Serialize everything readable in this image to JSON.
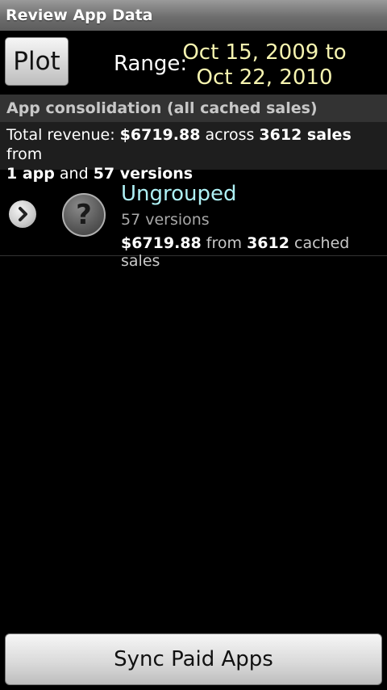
{
  "header": {
    "title": "Review App Data"
  },
  "toolbar": {
    "plot_label": "Plot",
    "range_label": "Range:",
    "range_start": "Oct 15, 2009 to",
    "range_end": "Oct 22, 2010"
  },
  "section": {
    "title": "App consolidation (all cached sales)"
  },
  "summary": {
    "prefix": "Total revenue: ",
    "revenue": "$6719.88",
    "across": " across ",
    "sales": "3612 sales",
    "from": " from",
    "apps": "1 app",
    "and": " and ",
    "versions": "57 versions"
  },
  "apps": [
    {
      "name": "Ungrouped",
      "versions": "57 versions",
      "revenue": "$6719.88",
      "from_text": " from ",
      "sales_count": "3612",
      "sales_suffix": " cached sales",
      "icon": "question-mark-icon"
    }
  ],
  "footer": {
    "sync_label": "Sync Paid Apps"
  },
  "colors": {
    "background": "#000000",
    "range_text": "#f6f4b0",
    "app_name": "#aef0f4",
    "section_bg": "#333333",
    "summary_bg": "#1e1e1e"
  }
}
